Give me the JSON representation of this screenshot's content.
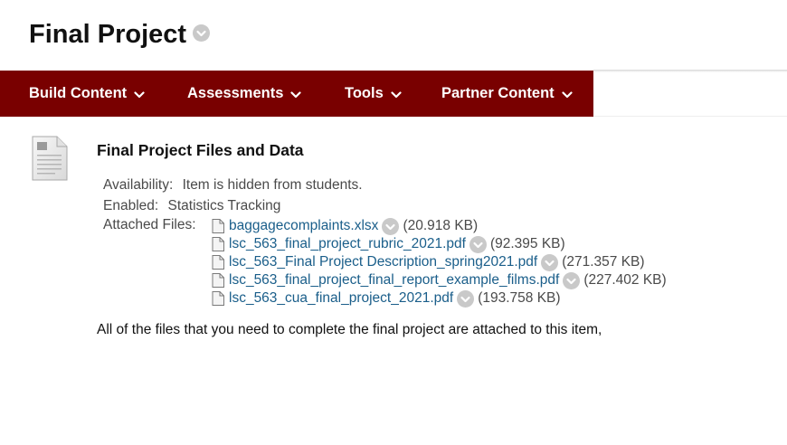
{
  "page": {
    "title": "Final Project"
  },
  "menu": {
    "items": [
      {
        "label": "Build Content"
      },
      {
        "label": "Assessments"
      },
      {
        "label": "Tools"
      },
      {
        "label": "Partner Content"
      }
    ]
  },
  "content_item": {
    "title": "Final Project Files and Data",
    "availability_label": "Availability:",
    "availability_value": "Item is hidden from students.",
    "enabled_label": "Enabled:",
    "enabled_value": "Statistics Tracking",
    "attached_label": "Attached Files:",
    "files": [
      {
        "name": "baggagecomplaints.xlsx",
        "size": "(20.918 KB)"
      },
      {
        "name": "lsc_563_final_project_rubric_2021.pdf",
        "size": "(92.395 KB)"
      },
      {
        "name": "lsc_563_Final Project Description_spring2021.pdf",
        "size": "(271.357 KB)"
      },
      {
        "name": "lsc_563_final_project_final_report_example_films.pdf",
        "size": "(227.402 KB)"
      },
      {
        "name": "lsc_563_cua_final_project_2021.pdf",
        "size": "(193.758 KB)"
      }
    ],
    "description": "All of the files that you need to complete the final project are attached to this item,"
  },
  "icons": {
    "title_menu": "chevron-down-circle-icon",
    "menu_caret": "chevron-down-icon",
    "item_type": "document-icon",
    "file": "file-icon",
    "file_menu": "chevron-down-circle-icon"
  },
  "colors": {
    "menubar": "#790000",
    "link": "#1a5e8a",
    "chevron_circle": "#c9c9c9"
  }
}
